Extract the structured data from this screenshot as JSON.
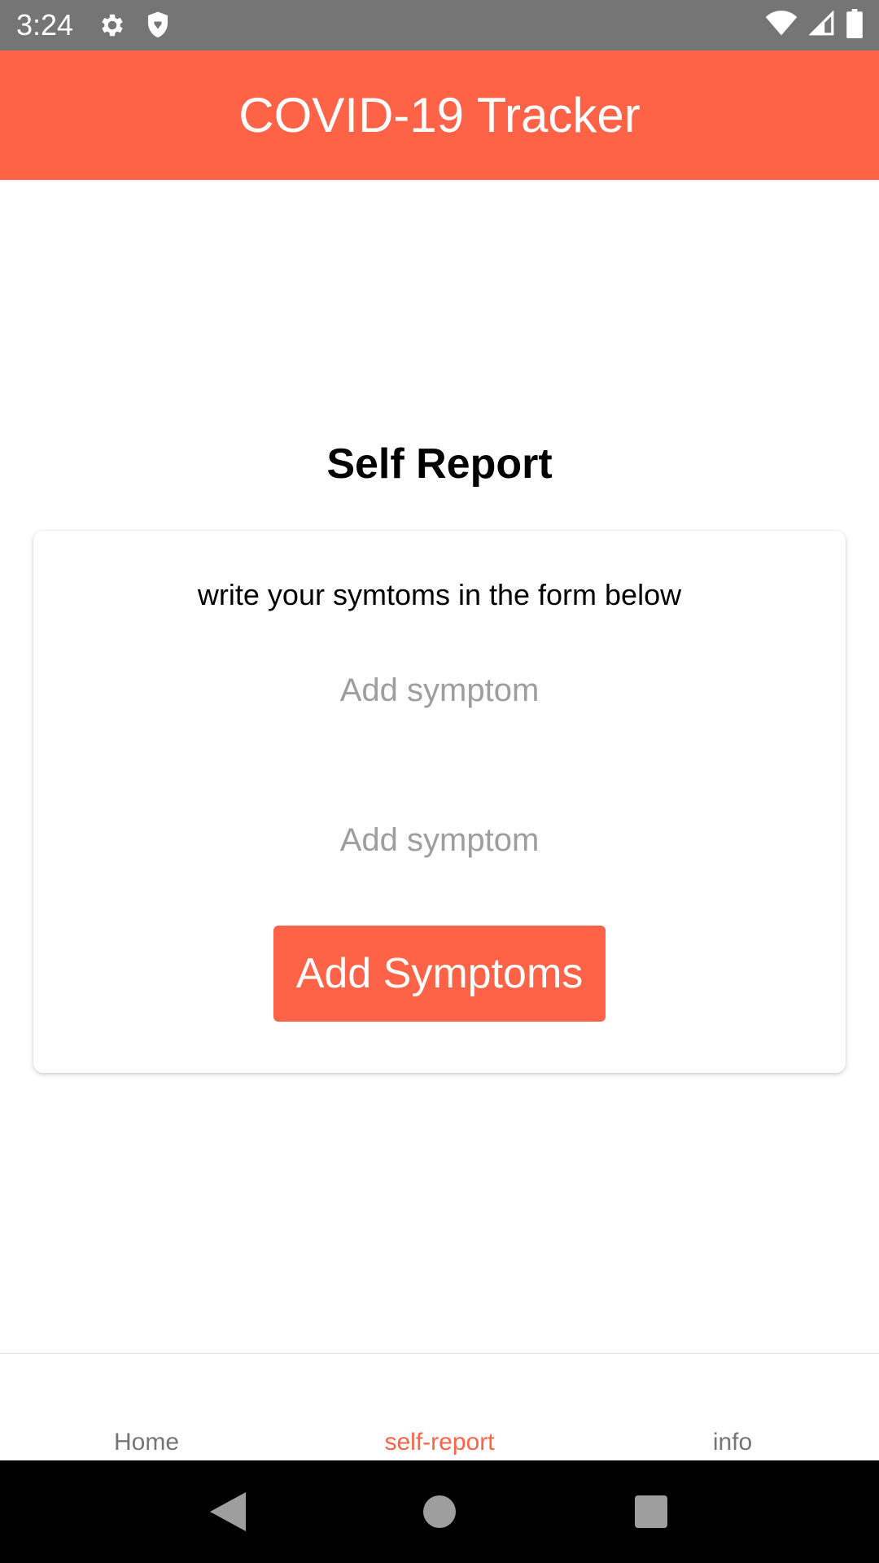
{
  "status_bar": {
    "time": "3:24",
    "icons_left": [
      "gear-icon",
      "shield-icon"
    ],
    "icons_right": [
      "wifi-icon",
      "signal-icon",
      "battery-icon"
    ]
  },
  "app_bar": {
    "title": "COVID-19 Tracker",
    "color": "#FF6347"
  },
  "main": {
    "heading": "Self Report",
    "card": {
      "instructions": "write your symtoms in the form below",
      "inputs": [
        {
          "value": "",
          "placeholder": "Add symptom"
        },
        {
          "value": "",
          "placeholder": "Add symptom"
        }
      ],
      "submit_label": "Add Symptoms"
    }
  },
  "tabs": [
    {
      "label": "Home",
      "active": false
    },
    {
      "label": "self-report",
      "active": true
    },
    {
      "label": "info",
      "active": false
    }
  ],
  "nav_bar": {
    "buttons": [
      "back-icon",
      "home-circle-icon",
      "recents-square-icon"
    ]
  },
  "colors": {
    "accent": "#FF6347",
    "status_bar": "#757575",
    "inactive_tab": "#757575",
    "placeholder": "#9e9e9e"
  }
}
